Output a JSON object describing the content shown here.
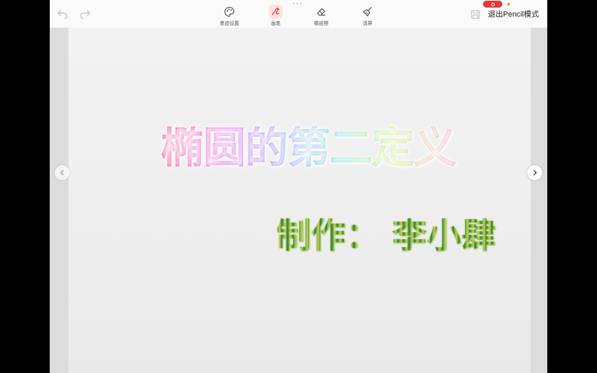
{
  "toolbar": {
    "tools": [
      {
        "label": "墨迹设置",
        "icon": "palette-icon"
      },
      {
        "label": "画笔",
        "icon": "pen-icon"
      },
      {
        "label": "橡皮擦",
        "icon": "eraser-icon"
      },
      {
        "label": "清屏",
        "icon": "broom-icon"
      }
    ],
    "exit_label": "退出Pencil模式",
    "accent": "#e53935"
  },
  "slide": {
    "title": "椭圆的第二定义",
    "author": "制作： 李小肆"
  }
}
